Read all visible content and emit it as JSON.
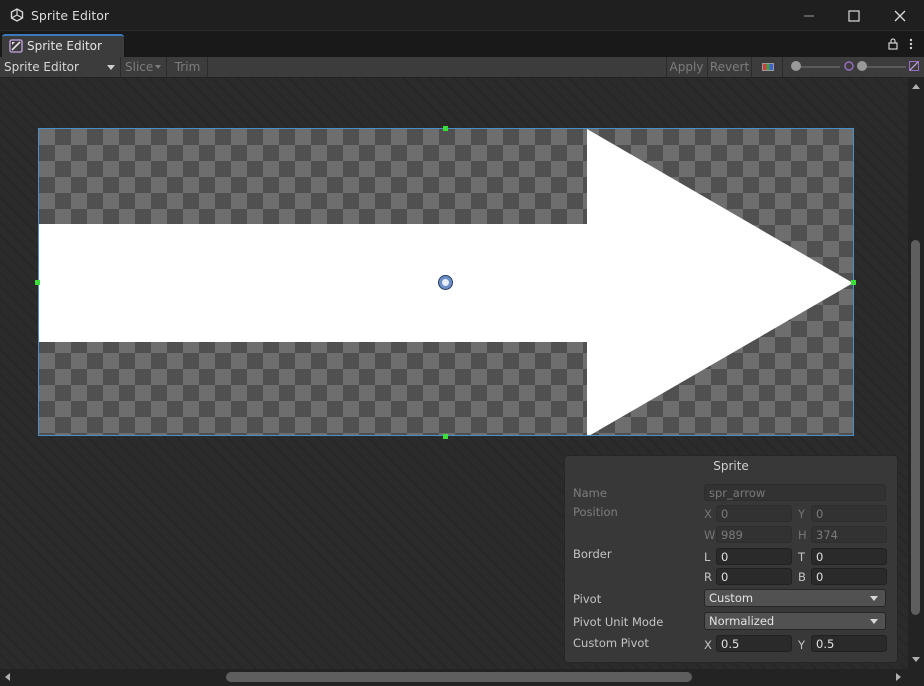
{
  "window": {
    "title": "Sprite Editor",
    "tab_label": "Sprite Editor"
  },
  "toolbar": {
    "mode": "Sprite Editor",
    "slice": "Slice",
    "trim": "Trim",
    "apply": "Apply",
    "revert": "Revert"
  },
  "sprite_panel": {
    "title": "Sprite",
    "name_label": "Name",
    "name_value": "spr_arrow",
    "position_label": "Position",
    "x_label": "X",
    "x_value": "0",
    "y_label": "Y",
    "y_value": "0",
    "w_label": "W",
    "w_value": "989",
    "h_label": "H",
    "h_value": "374",
    "border_label": "Border",
    "l_label": "L",
    "l_value": "0",
    "t_label": "T",
    "t_value": "0",
    "r_label": "R",
    "r_value": "0",
    "b_label": "B",
    "b_value": "0",
    "pivot_label": "Pivot",
    "pivot_value": "Custom",
    "pivot_unit_mode_label": "Pivot Unit Mode",
    "pivot_unit_mode_value": "Normalized",
    "custom_pivot_label": "Custom Pivot",
    "custom_pivot_x_label": "X",
    "custom_pivot_x_value": "0.5",
    "custom_pivot_y_label": "Y",
    "custom_pivot_y_value": "0.5"
  },
  "colors": {
    "accent": "#3a79bb",
    "selection_border": "#4a90c8",
    "handle": "#38e038"
  }
}
